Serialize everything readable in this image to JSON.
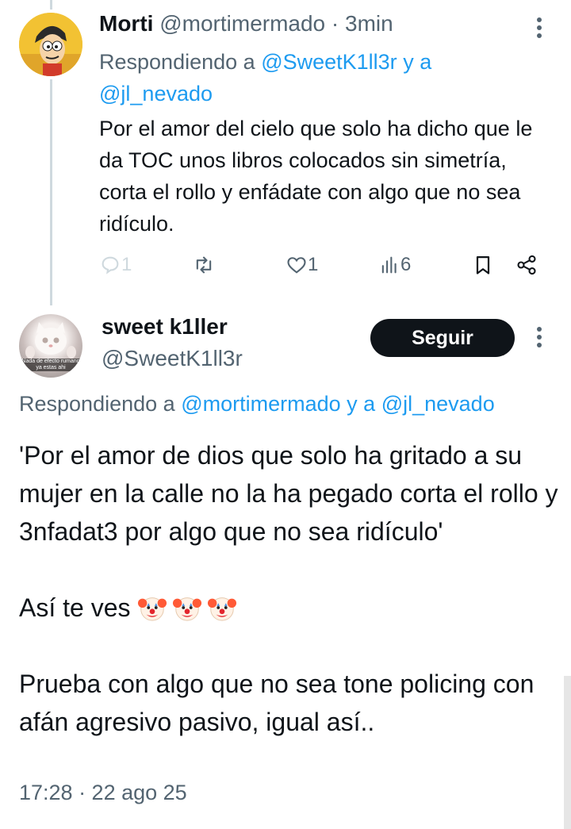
{
  "reply": {
    "author_name": "Morti",
    "author_handle": "@mortimermado",
    "separator": "·",
    "time": "3min",
    "replying_prefix": "Respondiendo a",
    "replying_to_1": "@SweetK1ll3r",
    "replying_join": "y a",
    "replying_to_2": "@jl_nevado",
    "text": "Por el amor del cielo que solo ha dicho que le da TOC unos libros colocados sin simetría,  corta el rollo y enfádate con algo que no sea ridículo.",
    "replies_count": "1",
    "likes_count": "1",
    "views_count": "6"
  },
  "main_tweet": {
    "author_name": "sweet k1ller",
    "author_handle": "@SweetK1ll3r",
    "avatar_caption": "Nada de efecto rumano ya estas ahi",
    "follow_label": "Seguir",
    "replying_prefix": "Respondiendo a",
    "replying_to_1": "@mortimermado",
    "replying_join": "y a",
    "replying_to_2": "@jl_nevado",
    "paragraph_1": "'Por el amor de dios que solo ha gritado a su mujer en la calle no la ha pegado corta el rollo y 3nfadat3 por algo que no sea ridículo'",
    "paragraph_2": "Así te ves",
    "paragraph_3": "Prueba con algo que no sea tone policing con afán agresivo pasivo, igual así..",
    "timestamp": "17:28 · 22 ago 25"
  },
  "icons": {
    "reply": "comment-icon",
    "retweet": "retweet-icon",
    "like": "heart-icon",
    "views": "bar-chart-icon",
    "bookmark": "bookmark-icon",
    "share": "share-icon",
    "clown": "clown-face-emoji"
  },
  "colors": {
    "link": "#1d9bf0",
    "secondary_text": "#536471",
    "primary_text": "#0f1419",
    "follow_button_bg": "#0f1419"
  }
}
